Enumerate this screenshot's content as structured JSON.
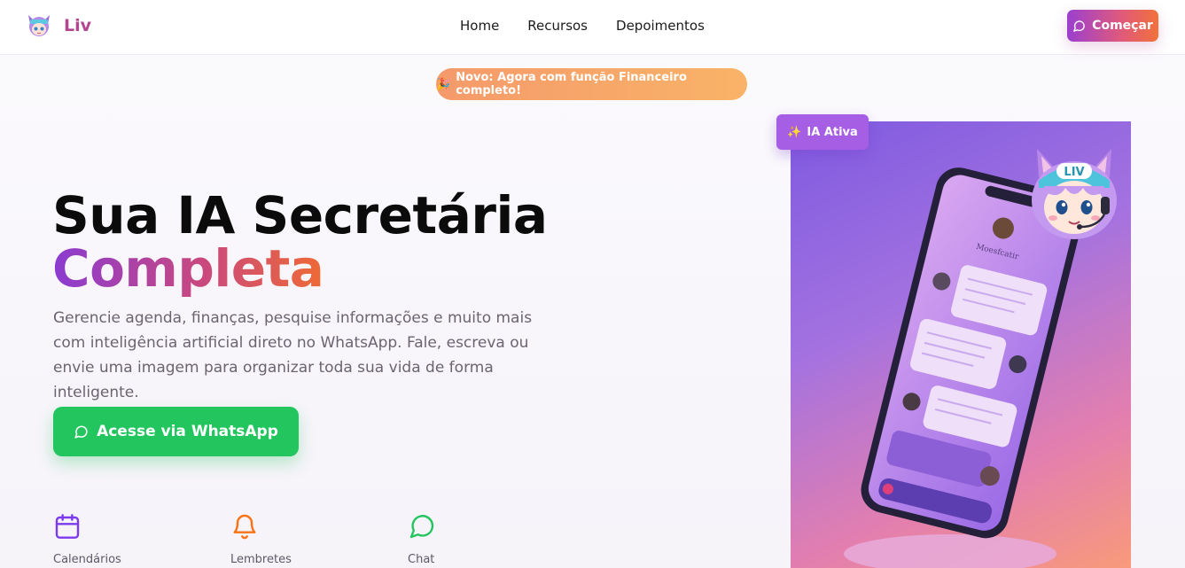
{
  "nav": {
    "brand": "Liv",
    "links": [
      "Home",
      "Recursos",
      "Depoimentos"
    ],
    "cta_label": "Começar"
  },
  "announcement": {
    "icon": "party-popper-icon",
    "text": "Novo: Agora com função Financeiro completo!"
  },
  "hero": {
    "title_line1": "Sua IA Secretária",
    "title_line2": "Completa",
    "description": "Gerencie agenda, finanças, pesquise informações e muito mais com inteligência artificial direto no WhatsApp. Fale, escreva ou envie uma imagem para organizar toda sua vida de forma inteligente.",
    "cta_label": "Acesse via WhatsApp"
  },
  "features": [
    {
      "label": "Calendários",
      "icon": "calendar-icon",
      "color": "#7c3aed"
    },
    {
      "label": "Lembretes",
      "icon": "bell-icon",
      "color": "#f97316"
    },
    {
      "label": "Chat",
      "icon": "chat-icon",
      "color": "#22c55e"
    }
  ],
  "showcase": {
    "badge_label": "IA Ativa",
    "mascot_cap_text": "LIV",
    "phone_contact_name": "Moesfcatir"
  },
  "colors": {
    "brand_gradient_start": "#9b3fd0",
    "brand_gradient_end": "#f2713a",
    "whatsapp_green": "#22c55e",
    "badge_orange": "#f59a6b"
  }
}
